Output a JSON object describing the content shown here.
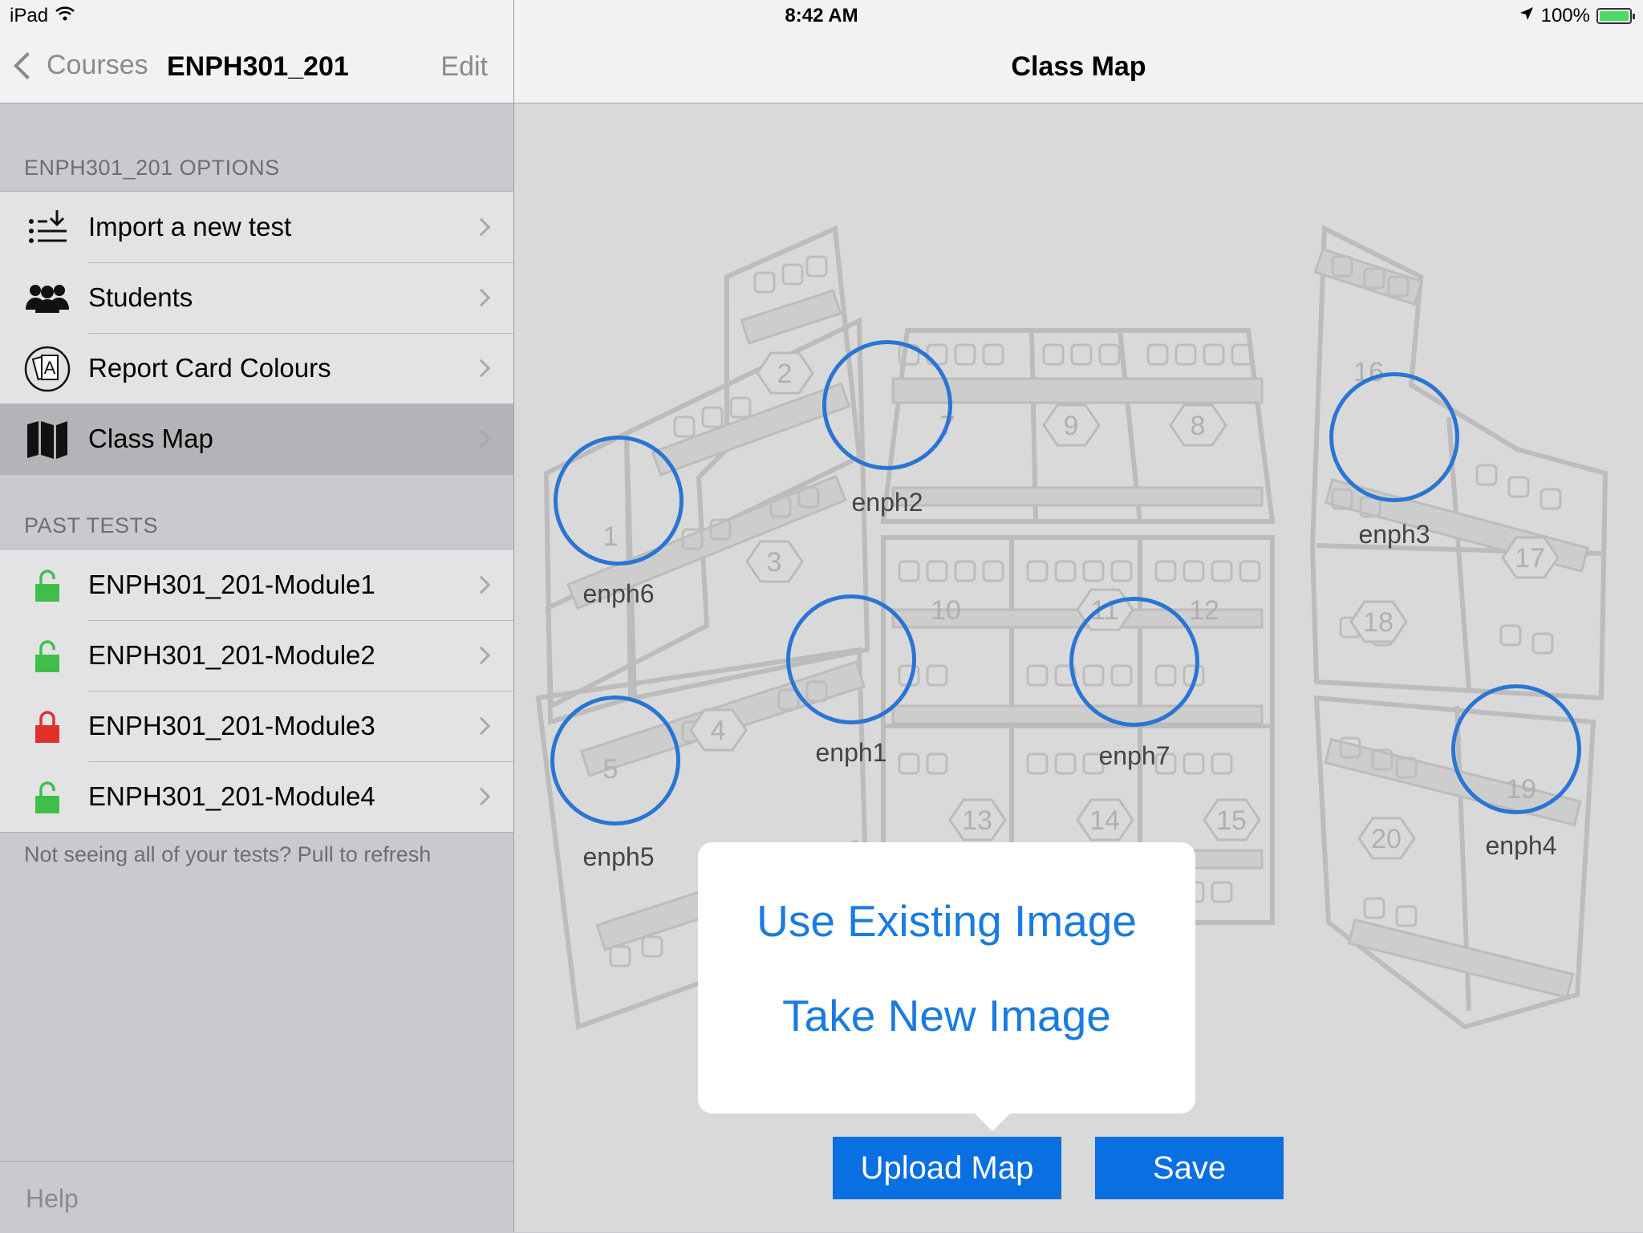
{
  "status_bar": {
    "device": "iPad",
    "time": "8:42 AM",
    "battery": "100%"
  },
  "sidebar": {
    "back_label": "Courses",
    "title": "ENPH301_201",
    "edit_label": "Edit",
    "options_header": "ENPH301_201 OPTIONS",
    "options": [
      {
        "label": "Import a new test",
        "icon": "import-list-icon"
      },
      {
        "label": "Students",
        "icon": "students-icon"
      },
      {
        "label": "Report Card Colours",
        "icon": "report-card-icon"
      },
      {
        "label": "Class Map",
        "icon": "map-icon",
        "selected": true
      }
    ],
    "past_tests_header": "PAST TESTS",
    "past_tests": [
      {
        "label": "ENPH301_201-Module1",
        "lock": "unlocked",
        "color": "#3fbf4a"
      },
      {
        "label": "ENPH301_201-Module2",
        "lock": "unlocked",
        "color": "#3fbf4a"
      },
      {
        "label": "ENPH301_201-Module3",
        "lock": "locked",
        "color": "#e0302a"
      },
      {
        "label": "ENPH301_201-Module4",
        "lock": "unlocked",
        "color": "#3fbf4a"
      }
    ],
    "refresh_hint": "Not seeing all of your tests? Pull to refresh",
    "help_label": "Help"
  },
  "main": {
    "title": "Class Map",
    "table_numbers": [
      "1",
      "2",
      "3",
      "4",
      "5",
      "7",
      "8",
      "9",
      "10",
      "11",
      "12",
      "13",
      "14",
      "15",
      "16",
      "17",
      "18",
      "19",
      "20"
    ],
    "seats": [
      "enph6",
      "enph2",
      "enph3",
      "enph1",
      "enph7",
      "enph5",
      "enph4"
    ],
    "popover": {
      "use_existing": "Use Existing Image",
      "take_new": "Take New Image"
    },
    "upload_label": "Upload Map",
    "save_label": "Save",
    "accent_color": "#2a75d4"
  }
}
